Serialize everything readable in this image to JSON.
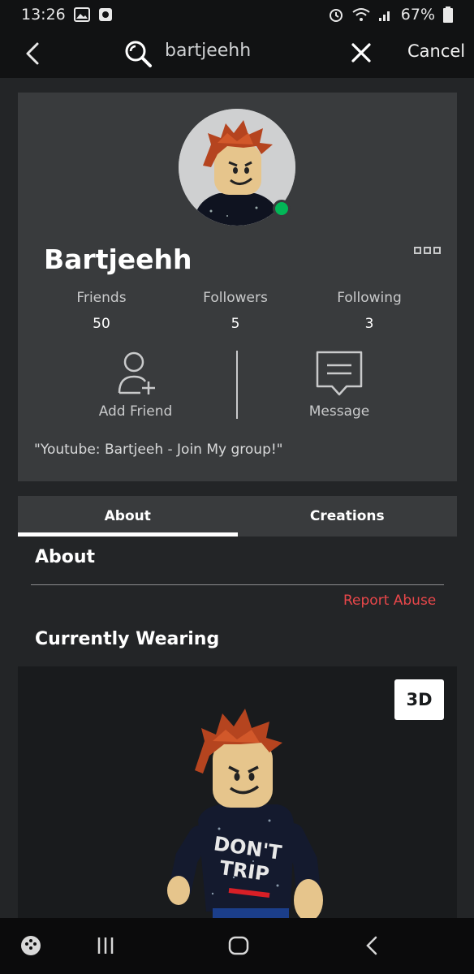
{
  "status_bar": {
    "time": "13:26",
    "battery": "67%"
  },
  "search": {
    "query": "bartjeehh",
    "cancel_label": "Cancel"
  },
  "profile": {
    "username": "Bartjeehh",
    "online": true,
    "stats": [
      {
        "label": "Friends",
        "value": "50"
      },
      {
        "label": "Followers",
        "value": "5"
      },
      {
        "label": "Following",
        "value": "3"
      }
    ],
    "actions": {
      "add_friend_label": "Add Friend",
      "message_label": "Message"
    },
    "bio": "\"Youtube: Bartjeeh - Join My group!\""
  },
  "tabs": [
    {
      "label": "About",
      "active": true
    },
    {
      "label": "Creations",
      "active": false
    }
  ],
  "about": {
    "heading": "About",
    "report_label": "Report Abuse"
  },
  "wearing": {
    "heading": "Currently Wearing",
    "view_toggle_label": "3D",
    "shirt_text_line1": "DON'T",
    "shirt_text_line2": "TRIP"
  },
  "colors": {
    "online": "#02b757",
    "report": "#e8474a",
    "card": "#393b3d",
    "background": "#232527"
  },
  "icons": {
    "back": "chevron-left-icon",
    "search": "search-icon",
    "clear": "close-icon",
    "more": "more-options-icon",
    "add_friend": "add-friend-icon",
    "message": "message-icon"
  }
}
